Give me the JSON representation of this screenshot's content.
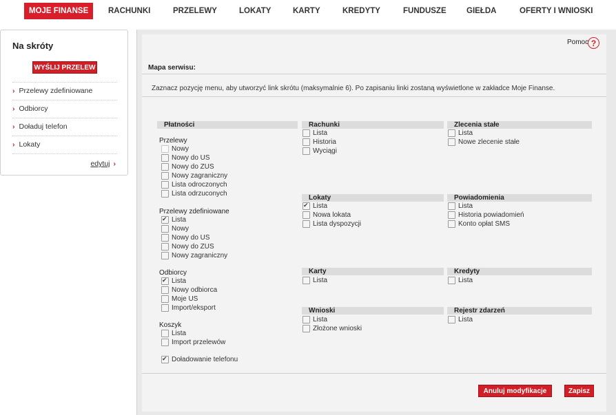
{
  "nav": {
    "items": [
      "MOJE FINANSE",
      "RACHUNKI",
      "PRZELEWY",
      "LOKATY",
      "KARTY",
      "KREDYTY",
      "FUNDUSZE",
      "GIEŁDA",
      "OFERTY I WNIOSKI"
    ]
  },
  "sidebar": {
    "title": "Na skróty",
    "send_button": "WYŚLIJ PRZELEW",
    "items": [
      "Przelewy zdefiniowane",
      "Odbiorcy",
      "Doładuj telefon",
      "Lokaty"
    ],
    "edit_label": "edytuj"
  },
  "main": {
    "help_label": "Pomoc",
    "help_icon": "?",
    "section_title": "Mapa serwisu:",
    "instruction": "Zaznacz pozycję menu, aby utworzyć link skrótu (maksymalnie 6). Po zapisaniu linki zostaną wyświetlone w zakładce Moje Finanse.",
    "platnosci": {
      "title": "Płatności",
      "przelewy": {
        "title": "Przelewy",
        "options": [
          "Nowy",
          "Nowy do US",
          "Nowy do ZUS",
          "Nowy zagraniczny",
          "Lista odroczonych",
          "Lista odrzuconych"
        ]
      },
      "przelewy_zdef": {
        "title": "Przelewy zdefiniowane",
        "options": [
          "Lista",
          "Nowy",
          "Nowy do US",
          "Nowy do ZUS",
          "Nowy zagraniczny"
        ]
      },
      "odbiorcy": {
        "title": "Odbiorcy",
        "options": [
          "Lista",
          "Nowy odbiorca",
          "Moje US",
          "Import/eksport"
        ]
      },
      "koszyk": {
        "title": "Koszyk",
        "options": [
          "Lista",
          "Import przelewów"
        ]
      },
      "doladowanie": "Doładowanie telefonu"
    },
    "rachunki": {
      "title": "Rachunki",
      "options": [
        "Lista",
        "Historia",
        "Wyciągi"
      ]
    },
    "zlecenia": {
      "title": "Zlecenia stałe",
      "options": [
        "Lista",
        "Nowe zlecenie stałe"
      ]
    },
    "lokaty": {
      "title": "Lokaty",
      "options": [
        "Lista",
        "Nowa lokata",
        "Lista dyspozycji"
      ]
    },
    "powiadomienia": {
      "title": "Powiadomienia",
      "options": [
        "Lista",
        "Historia powiadomień",
        "Konto opłat SMS"
      ]
    },
    "karty": {
      "title": "Karty",
      "options": [
        "Lista"
      ]
    },
    "kredyty": {
      "title": "Kredyty",
      "options": [
        "Lista"
      ]
    },
    "wnioski": {
      "title": "Wnioski",
      "options": [
        "Lista",
        "Złożone wnioski"
      ]
    },
    "rejestr": {
      "title": "Rejestr zdarzeń",
      "options": [
        "Lista"
      ]
    },
    "cancel_button": "Anuluj modyfikacje",
    "save_button": "Zapisz"
  },
  "colors": {
    "accent": "#d01f26",
    "header_bg": "#dcdcdc",
    "panel_bg": "#f3f3f3"
  }
}
